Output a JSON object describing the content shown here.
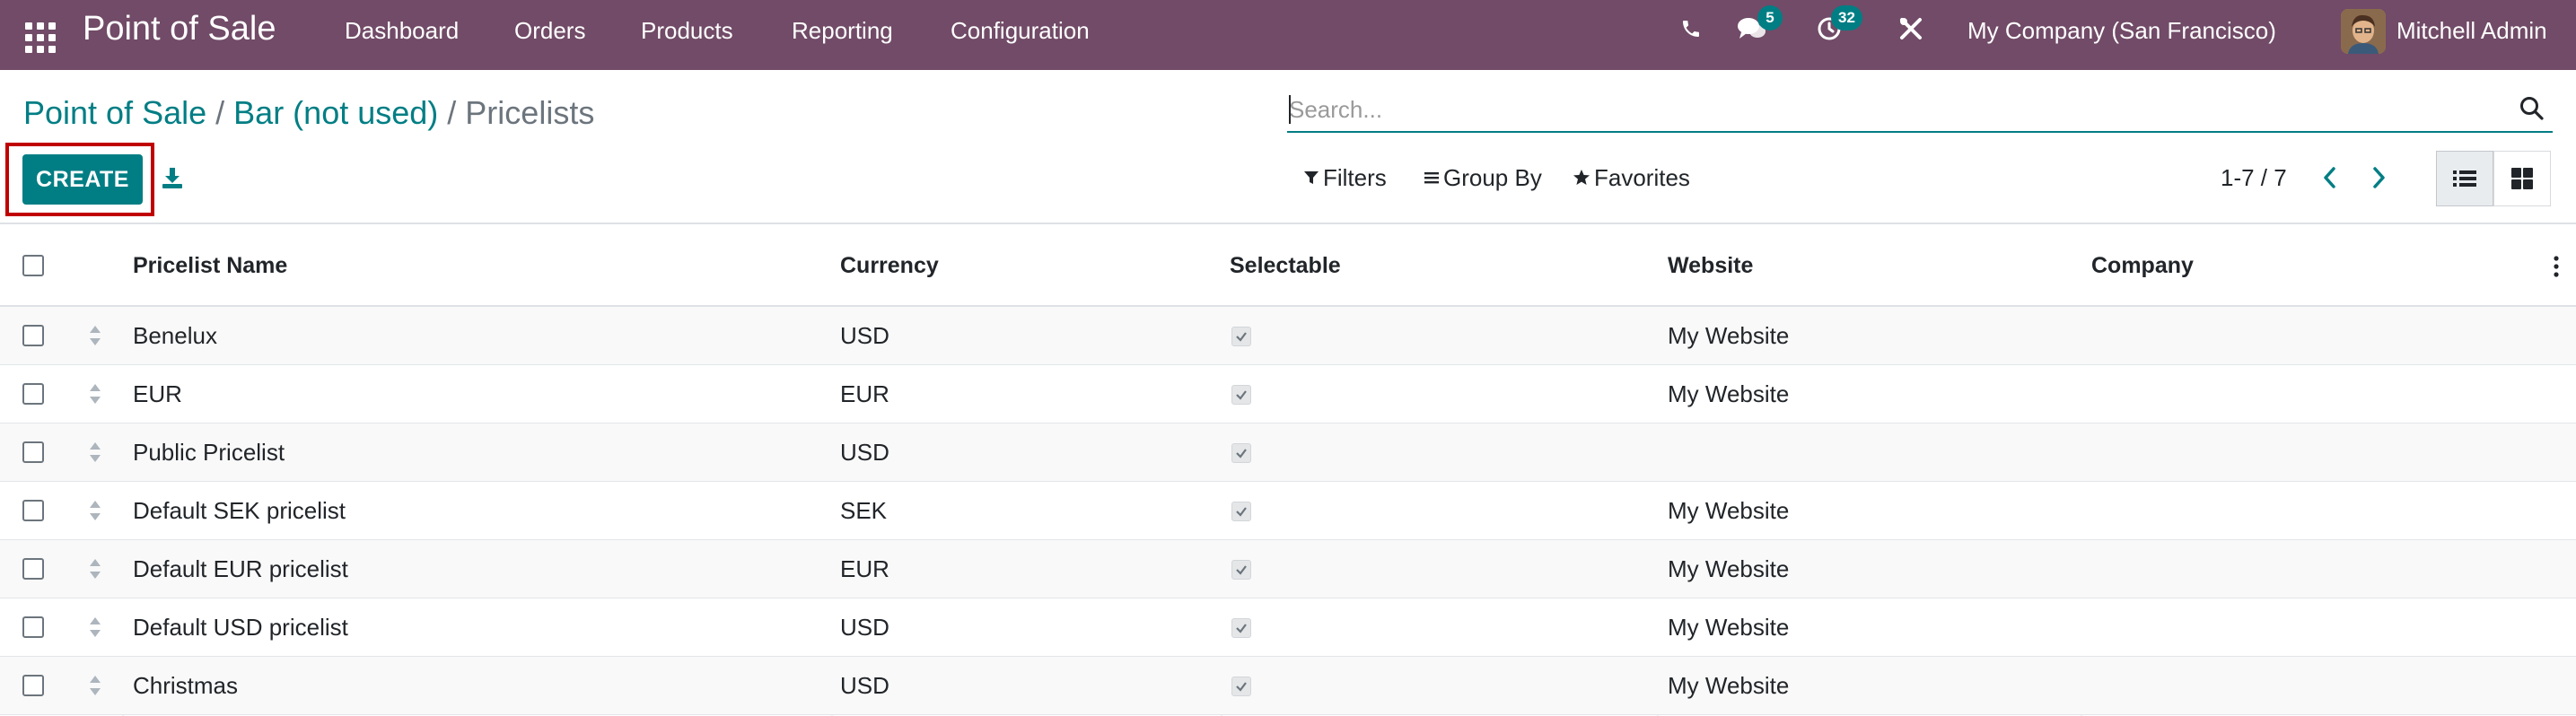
{
  "navbar": {
    "brand": "Point of Sale",
    "menu": [
      "Dashboard",
      "Orders",
      "Products",
      "Reporting",
      "Configuration"
    ],
    "messages_badge": "5",
    "activities_badge": "32",
    "company": "My Company (San Francisco)",
    "user": "Mitchell Admin",
    "bg_color": "#714b67",
    "icons": [
      "apps-grid-icon",
      "phone-icon",
      "chat-icon",
      "clock-icon",
      "tools-icon"
    ]
  },
  "breadcrumb": {
    "items": [
      "Point of Sale",
      "Bar (not used)"
    ],
    "separator": "/",
    "current": "Pricelists"
  },
  "search": {
    "placeholder": "Search...",
    "value": ""
  },
  "actions": {
    "create_label": "CREATE",
    "accent_color": "#017e84",
    "highlight_color": "#c00000"
  },
  "filters": {
    "filters_label": "Filters",
    "group_by_label": "Group By",
    "favorites_label": "Favorites"
  },
  "pager": {
    "value": "1-7 / 7"
  },
  "table": {
    "columns": [
      "Pricelist Name",
      "Currency",
      "Selectable",
      "Website",
      "Company"
    ],
    "rows": [
      {
        "name": "Benelux",
        "currency": "USD",
        "selectable": true,
        "website": "My Website",
        "company": ""
      },
      {
        "name": "EUR",
        "currency": "EUR",
        "selectable": true,
        "website": "My Website",
        "company": ""
      },
      {
        "name": "Public Pricelist",
        "currency": "USD",
        "selectable": true,
        "website": "",
        "company": ""
      },
      {
        "name": "Default SEK pricelist",
        "currency": "SEK",
        "selectable": true,
        "website": "My Website",
        "company": ""
      },
      {
        "name": "Default EUR pricelist",
        "currency": "EUR",
        "selectable": true,
        "website": "My Website",
        "company": ""
      },
      {
        "name": "Default USD pricelist",
        "currency": "USD",
        "selectable": true,
        "website": "My Website",
        "company": ""
      },
      {
        "name": "Christmas",
        "currency": "USD",
        "selectable": true,
        "website": "My Website",
        "company": ""
      }
    ]
  }
}
